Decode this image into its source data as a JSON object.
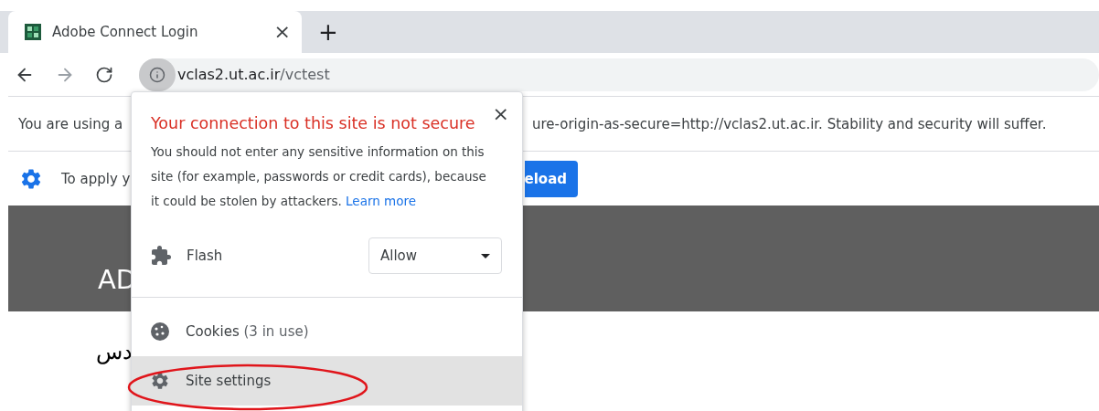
{
  "tab": {
    "title": "Adobe Connect Login",
    "close": "×",
    "new_tab": "+"
  },
  "address_bar": {
    "host": "vclas2.ut.ac.ir",
    "path": "/vctest"
  },
  "infobars": [
    {
      "kind": "text",
      "left": "You are using a",
      "right": "ure-origin-as-secure=http://vclas2.ut.ac.ir. Stability and security will suffer."
    },
    {
      "kind": "action",
      "left": "To apply y",
      "button": "eload"
    }
  ],
  "page": {
    "banner": "AD",
    "heading": "دس"
  },
  "popup": {
    "close": "×",
    "title": "Your connection to this site is not secure",
    "body": "You should not enter any sensitive information on this site (for example, passwords or credit cards), because it could be stolen by attackers.",
    "link": "Learn more",
    "permission": {
      "label": "Flash",
      "value": "Allow"
    },
    "items": [
      {
        "kind": "cookies",
        "label": "Cookies",
        "note": "(3 in use)",
        "hovered": false
      },
      {
        "kind": "settings",
        "label": "Site settings",
        "hovered": true,
        "circled": true
      }
    ]
  }
}
